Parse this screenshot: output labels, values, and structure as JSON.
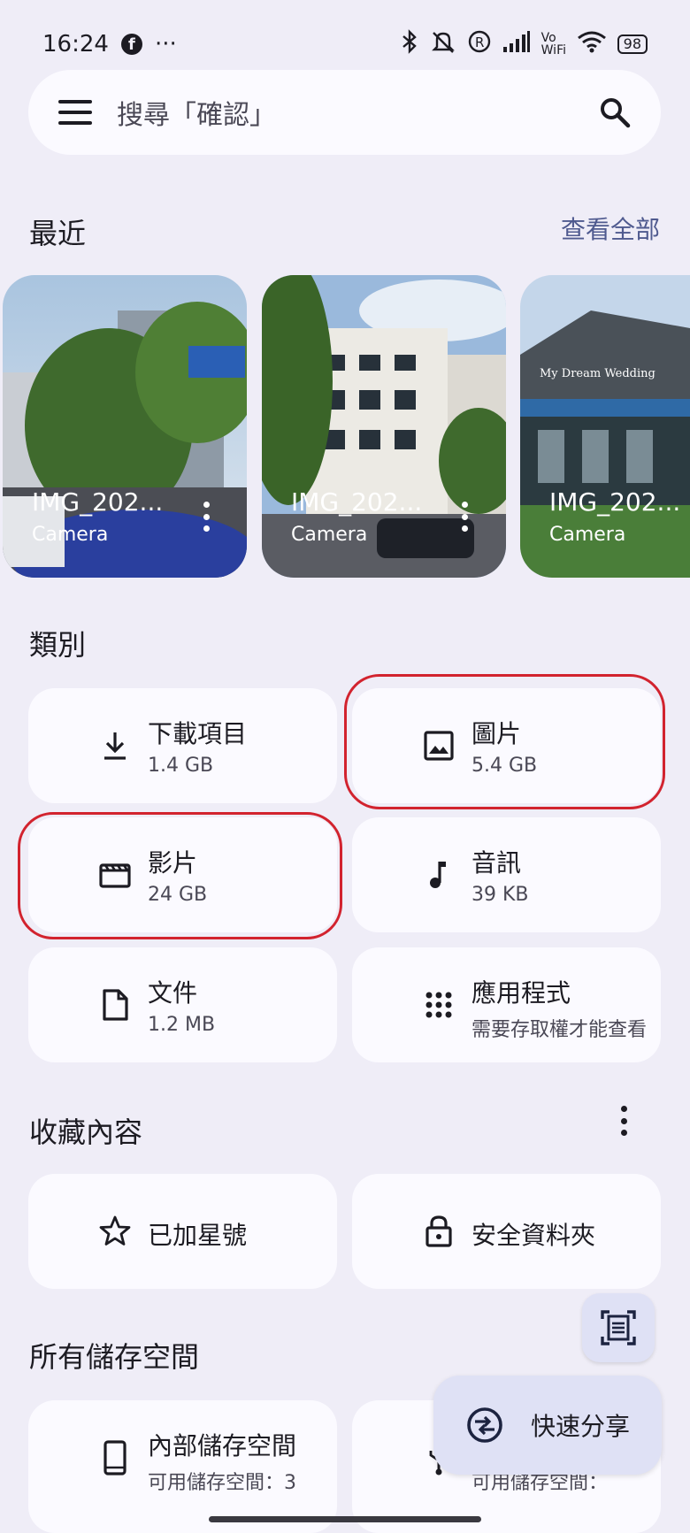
{
  "status": {
    "time": "16:24",
    "battery": "98",
    "network": "Vo WiFi"
  },
  "search": {
    "placeholder": "搜尋「確認」"
  },
  "recent": {
    "title": "最近",
    "view_all": "查看全部",
    "items": [
      {
        "name": "IMG_202...",
        "source": "Camera"
      },
      {
        "name": "IMG_202...",
        "source": "Camera"
      },
      {
        "name": "IMG_202...",
        "source": "Camera"
      }
    ]
  },
  "categories": {
    "title": "類別",
    "items": [
      {
        "label": "下載項目",
        "size": "1.4 GB",
        "icon": "download-icon"
      },
      {
        "label": "圖片",
        "size": "5.4 GB",
        "icon": "image-icon"
      },
      {
        "label": "影片",
        "size": "24 GB",
        "icon": "video-icon"
      },
      {
        "label": "音訊",
        "size": "39 KB",
        "icon": "music-note-icon"
      },
      {
        "label": "文件",
        "size": "1.2 MB",
        "icon": "document-icon"
      },
      {
        "label": "應用程式",
        "size": "需要存取權才能查看",
        "icon": "apps-grid-icon"
      }
    ]
  },
  "collections": {
    "title": "收藏內容",
    "items": [
      {
        "label": "已加星號",
        "icon": "star-icon"
      },
      {
        "label": "安全資料夾",
        "icon": "lock-icon"
      }
    ]
  },
  "storage": {
    "title": "所有儲存空間",
    "items": [
      {
        "label": "內部儲存空間",
        "sub": "可用儲存空間：3",
        "icon": "phone-icon"
      },
      {
        "label": "",
        "sub": "可用儲存空間：",
        "icon": "usb-icon"
      }
    ]
  },
  "fab": {
    "quick_share": "快速分享"
  },
  "colors": {
    "background": "#efedf7",
    "card": "#fbfaff",
    "accent": "#4f5a8f",
    "highlight": "#d2232e"
  }
}
